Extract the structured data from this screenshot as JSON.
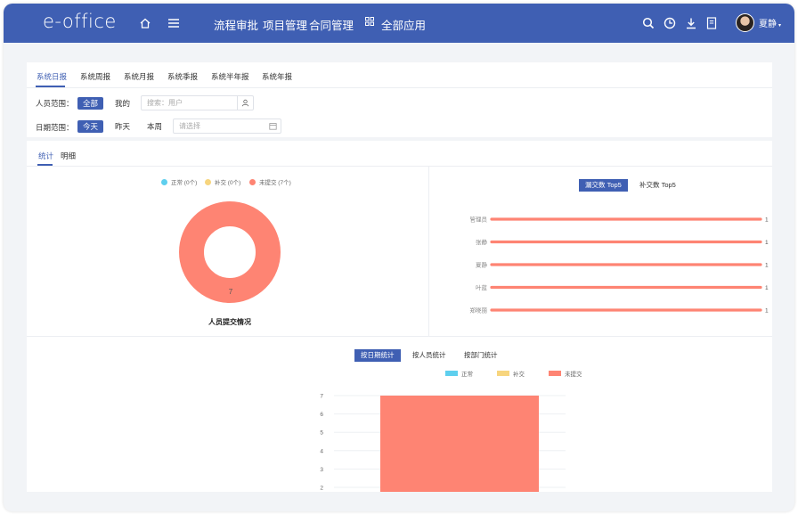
{
  "app": {
    "logo": "e-office",
    "user_name": "夏静"
  },
  "topnav": [
    "流程审批",
    "项目管理",
    "合同管理"
  ],
  "all_apps": "全部应用",
  "report_tabs": [
    "系统日报",
    "系统周报",
    "系统月报",
    "系统季报",
    "系统半年报",
    "系统年报"
  ],
  "filters": {
    "person_label": "人员范围：",
    "person_options": [
      "全部",
      "我的"
    ],
    "person_placeholder": "搜索：用户",
    "date_label": "日期范围：",
    "date_options": [
      "今天",
      "昨天",
      "本周"
    ],
    "date_placeholder": "请选择"
  },
  "view_tabs": [
    "统计",
    "明细"
  ],
  "donut": {
    "legend": [
      "正常 (0个)",
      "补交 (0个)",
      "未提交 (7个)"
    ],
    "center_value": "7",
    "title": "人员提交情况"
  },
  "top5": {
    "tabs": [
      "漏交数 Top5",
      "补交数 Top5"
    ],
    "rows": [
      {
        "name": "管理员",
        "value": 1
      },
      {
        "name": "张静",
        "value": 1
      },
      {
        "name": "夏静",
        "value": 1
      },
      {
        "name": "叶蓝",
        "value": 1
      },
      {
        "name": "郑晓丽",
        "value": 1
      }
    ]
  },
  "stat_tabs": [
    "按日期统计",
    "按人员统计",
    "按部门统计"
  ],
  "bar_legend": [
    "正常",
    "补交",
    "未提交"
  ],
  "colors": {
    "brand": "#3f5fb3",
    "normal": "#5ecfee",
    "late": "#f7d57e",
    "missing": "#fe8473"
  },
  "chart_data": [
    {
      "type": "pie",
      "categories": [
        "正常 (0个)",
        "补交 (0个)",
        "未提交 (7个)"
      ],
      "values": [
        0,
        0,
        7
      ],
      "title": "人员提交情况"
    },
    {
      "type": "bar",
      "categories": [
        "管理员",
        "张静",
        "夏静",
        "叶蓝",
        "郑晓丽"
      ],
      "values": [
        1,
        1,
        1,
        1,
        1
      ]
    },
    {
      "type": "bar",
      "series": [
        {
          "name": "正常",
          "values": [
            0
          ]
        },
        {
          "name": "补交",
          "values": [
            0
          ]
        },
        {
          "name": "未提交",
          "values": [
            7
          ]
        }
      ],
      "y_ticks": [
        2,
        3,
        4,
        5,
        6,
        7
      ]
    }
  ]
}
